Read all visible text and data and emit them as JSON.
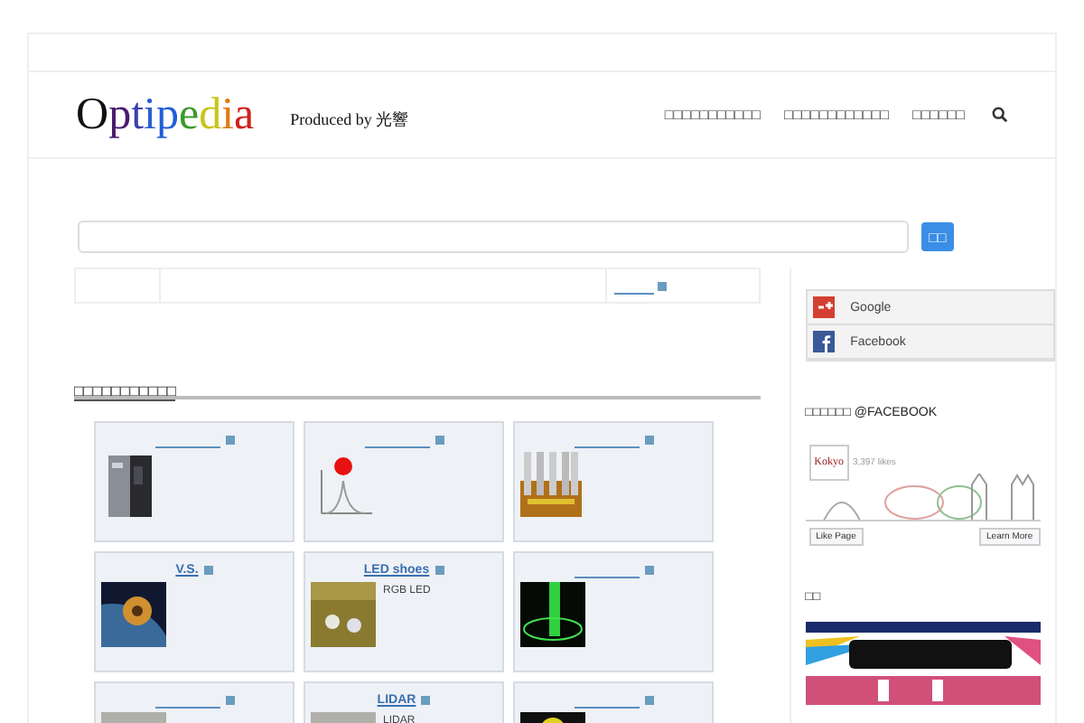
{
  "header": {
    "logo": [
      {
        "letter": "O",
        "color": "#111111"
      },
      {
        "letter": "p",
        "color": "#4b1a6e"
      },
      {
        "letter": "t",
        "color": "#3b3fae"
      },
      {
        "letter": "i",
        "color": "#2a5fd0"
      },
      {
        "letter": "p",
        "color": "#1f5fd8"
      },
      {
        "letter": "e",
        "color": "#3a9a2a"
      },
      {
        "letter": "d",
        "color": "#c9c41a"
      },
      {
        "letter": "i",
        "color": "#e07a10"
      },
      {
        "letter": "a",
        "color": "#d0201a"
      }
    ],
    "tagline": "Produced by 光響",
    "nav": [
      "□□□□□□□□□□□",
      "□□□□□□□□□□□□",
      "□□□□□□"
    ]
  },
  "search": {
    "button": "□□"
  },
  "section_title": "□□□□□□□□□□□",
  "cards": [
    {
      "kind": "picture"
    },
    {
      "kind": "picture"
    },
    {
      "kind": "picture"
    },
    {
      "title": "V.S.",
      "kind": "picture"
    },
    {
      "title": "LED shoes",
      "description": "RGB LED",
      "kind": "picture"
    },
    {
      "kind": "picture"
    },
    {
      "kind": "picture"
    },
    {
      "title": "LIDAR",
      "description": "LIDAR",
      "kind": "picture"
    },
    {
      "kind": "picture"
    }
  ],
  "sidebar": {
    "share": [
      {
        "kind": "google",
        "label": "Google"
      },
      {
        "kind": "facebook",
        "label": "Facebook"
      }
    ],
    "fb_heading": "□□□□□□ @FACEBOOK",
    "fb_widget": {
      "page": "Kokyo",
      "likes": "3,397 likes",
      "like_button": "Like Page",
      "learn_button": "Learn More"
    },
    "ad_heading": "□□"
  }
}
